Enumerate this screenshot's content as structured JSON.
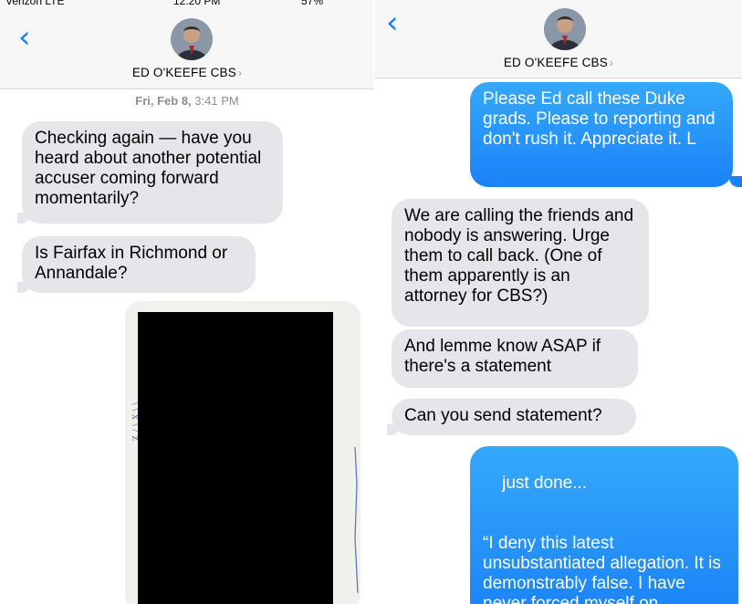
{
  "left": {
    "status": {
      "carrier": "Verizon LTE",
      "time": "12:20 PM",
      "battery": "57%"
    },
    "header": {
      "back_icon": "chevron-left-icon",
      "contact_name": "ED O'KEEFE CBS",
      "chevron": "›"
    },
    "timestamp": {
      "day": "Fri, Feb 8,",
      "time": "3:41 PM"
    },
    "messages": [
      {
        "direction": "incoming",
        "text": "Checking again — have you heard about another potential accuser coming forward momentarily?"
      },
      {
        "direction": "incoming",
        "text": "Is Fairfax in Richmond or Annandale?"
      }
    ],
    "attachment": {
      "type": "photo",
      "content": "redacted document photo"
    }
  },
  "right": {
    "header": {
      "back_icon": "chevron-left-icon",
      "contact_name": "ED O'KEEFE CBS",
      "chevron": "›"
    },
    "messages": [
      {
        "direction": "outgoing",
        "text": "Please Ed call these Duke grads. Please to reporting and don't rush it. Appreciate it. L"
      },
      {
        "direction": "incoming",
        "text": "We are calling the friends and nobody is answering. Urge them to call back. (One of them apparently is an attorney for CBS?)"
      },
      {
        "direction": "incoming",
        "text": "And lemme know ASAP if there's a statement"
      },
      {
        "direction": "incoming",
        "text": "Can you send statement?"
      },
      {
        "direction": "outgoing",
        "text": "just done...\n\n\n“I deny this latest unsubstantiated allegation. It is demonstrably false. I have never forced myself on"
      }
    ]
  },
  "colors": {
    "blue_bubble": "#1a82f7",
    "gray_bubble": "#e5e5ea",
    "ios_blue": "#147efb"
  }
}
